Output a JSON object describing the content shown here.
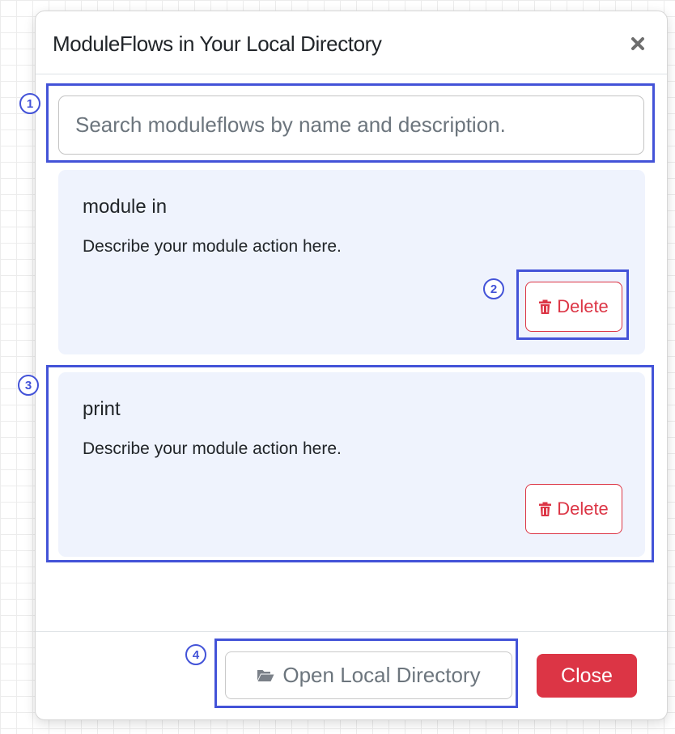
{
  "modal": {
    "title": "ModuleFlows in Your Local Directory",
    "close_icon": "close-x-icon"
  },
  "search": {
    "placeholder": "Search moduleflows by name and description.",
    "value": ""
  },
  "moduleflows": [
    {
      "name": "module in",
      "description": "Describe your module action here.",
      "delete_label": "Delete",
      "delete_icon": "trash-icon"
    },
    {
      "name": "print",
      "description": "Describe your module action here.",
      "delete_label": "Delete",
      "delete_icon": "trash-icon"
    }
  ],
  "footer": {
    "open_directory_label": "Open Local Directory",
    "open_directory_icon": "folder-open-icon",
    "close_label": "Close"
  },
  "annotations": [
    "1",
    "2",
    "3",
    "4"
  ],
  "colors": {
    "danger": "#dc3545",
    "card_background": "#eff3fd",
    "annotation": "#4353d8",
    "grid_line": "#ececec"
  }
}
